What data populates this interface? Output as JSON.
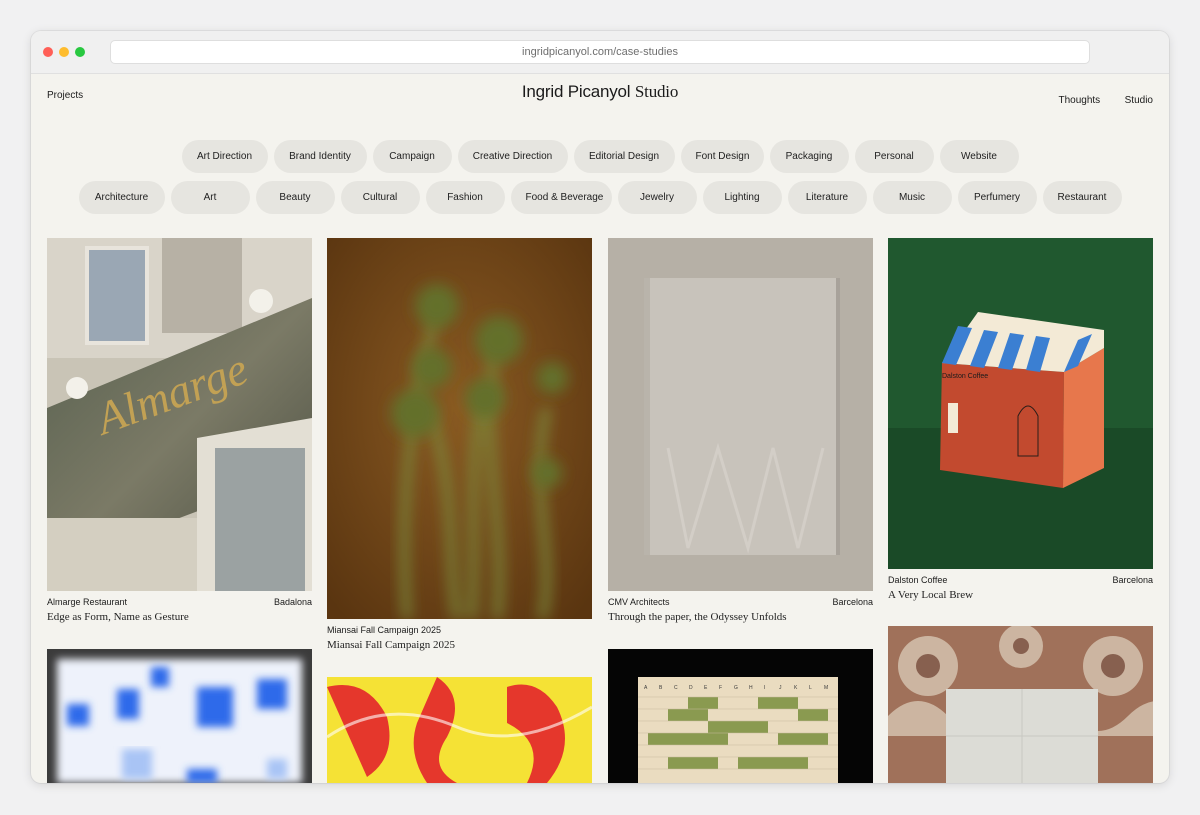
{
  "browser": {
    "url": "ingridpicanyol.com/case-studies"
  },
  "nav": {
    "left": "Projects",
    "brand_sans": "Ingrid Picanyol",
    "brand_serif": "Studio",
    "right": [
      "Thoughts",
      "Studio"
    ]
  },
  "filters": {
    "disciplines": [
      "Art Direction",
      "Brand Identity",
      "Campaign",
      "Creative Direction",
      "Editorial Design",
      "Font Design",
      "Packaging",
      "Personal",
      "Website"
    ],
    "sectors": [
      "Architecture",
      "Art",
      "Beauty",
      "Cultural",
      "Fashion",
      "Food & Beverage",
      "Jewelry",
      "Lighting",
      "Literature",
      "Music",
      "Perfumery",
      "Restaurant"
    ]
  },
  "projects": [
    {
      "client": "Almarge Restaurant",
      "location": "Badalona",
      "subtitle": "Edge as Form, Name as Gesture",
      "sign_text": "Almarge"
    },
    {
      "client": "Miansai Fall Campaign 2025",
      "location": "",
      "subtitle": "Miansai Fall Campaign 2025"
    },
    {
      "client": "CMV Architects",
      "location": "Barcelona",
      "subtitle": "Through the paper, the Odyssey Unfolds"
    },
    {
      "client": "Dalston Coffee",
      "location": "Barcelona",
      "subtitle": "A Very Local Brew",
      "box_text": "Dalston Coffee"
    }
  ],
  "chart_letters": [
    "A",
    "B",
    "C",
    "D",
    "E",
    "F",
    "G",
    "H",
    "I",
    "J",
    "K",
    "L",
    "M"
  ],
  "colors": {
    "background": "#f4f3ee",
    "pill": "#e6e5e0",
    "green_card": "#1f5a34"
  }
}
